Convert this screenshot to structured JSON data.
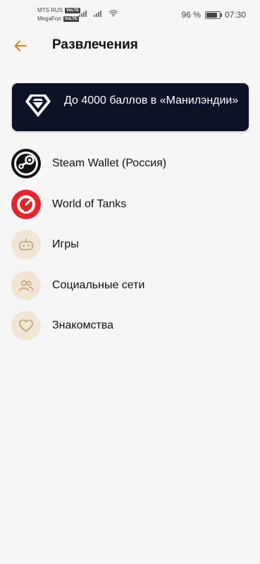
{
  "status_bar": {
    "carrier1": "MTS RUS",
    "carrier2": "MegaFon",
    "volte_badge": "VoLTE",
    "battery_percent": "96 %",
    "battery_level": 0.96,
    "time": "07:30"
  },
  "header": {
    "title": "Развлечения",
    "back_icon": "arrow-left-icon"
  },
  "banner": {
    "text": "До 4000 баллов в «Манилэндии»",
    "icon": "diamond-icon"
  },
  "items": [
    {
      "label": "Steam Wallet (Россия)",
      "icon": "steam-logo-icon"
    },
    {
      "label": "World of Tanks",
      "icon": "world-of-tanks-logo-icon"
    },
    {
      "label": "Игры",
      "icon": "gamepad-icon"
    },
    {
      "label": "Социальные сети",
      "icon": "people-icon"
    },
    {
      "label": "Знакомства",
      "icon": "heart-icon"
    }
  ],
  "colors": {
    "accent": "#c8862a",
    "banner_bg": "#0d1226",
    "steam_bg": "#111111",
    "wot_bg": "#e1262d",
    "icon_circle_bg": "#f1e5d6",
    "icon_stroke": "#c9a47c"
  }
}
